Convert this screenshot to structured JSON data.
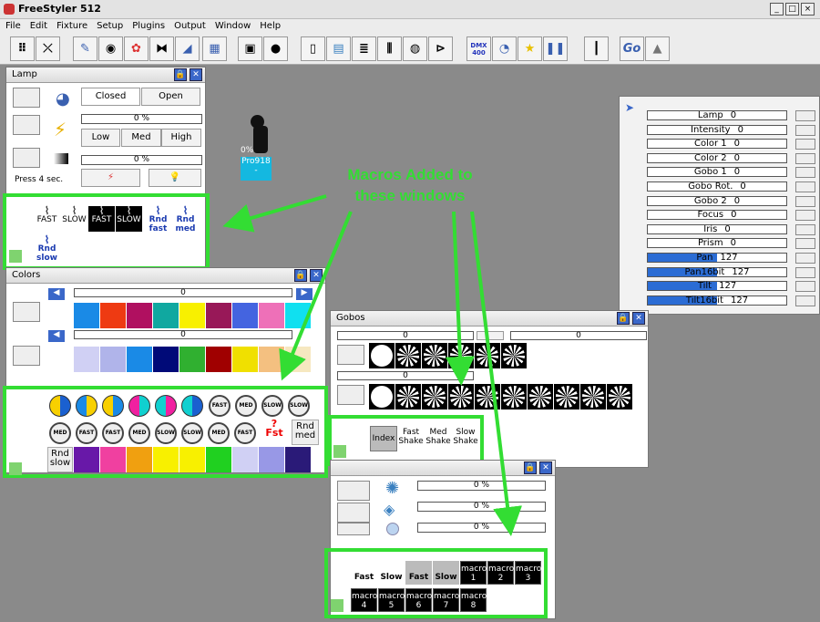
{
  "app": {
    "title": "FreeStyler 512"
  },
  "menu": [
    "File",
    "Edit",
    "Fixture",
    "Setup",
    "Plugins",
    "Output",
    "Window",
    "Help"
  ],
  "toolbar": {
    "dmx_label": "DMX",
    "dmx_sub": "400",
    "go_label": "Go"
  },
  "lamp": {
    "title": "Lamp",
    "closed": "Closed",
    "open": "Open",
    "percent1": "0 %",
    "low": "Low",
    "med": "Med",
    "high": "High",
    "percent2": "0 %",
    "press_label": "Press 4 sec.",
    "macros": [
      {
        "label": "FAST",
        "style": "w"
      },
      {
        "label": "SLOW",
        "style": "w"
      },
      {
        "label": "FAST",
        "style": "b"
      },
      {
        "label": "SLOW",
        "style": "b"
      },
      {
        "label": "Rnd fast",
        "style": "r"
      },
      {
        "label": "Rnd med",
        "style": "r"
      },
      {
        "label": "Rnd slow",
        "style": "r"
      }
    ]
  },
  "fixture": {
    "label": "Pro918",
    "value": "0%",
    "sub": "-"
  },
  "annotation": {
    "text": "Macros Added to these windows",
    "color": "#33dd33"
  },
  "channels": [
    {
      "label": "Lamp",
      "value": "0",
      "fill": 0
    },
    {
      "label": "Intensity",
      "value": "0",
      "fill": 0
    },
    {
      "label": "Color 1",
      "value": "0",
      "fill": 0
    },
    {
      "label": "Color 2",
      "value": "0",
      "fill": 0
    },
    {
      "label": "Gobo 1",
      "value": "0",
      "fill": 0
    },
    {
      "label": "Gobo Rot.",
      "value": "0",
      "fill": 0
    },
    {
      "label": "Gobo 2",
      "value": "0",
      "fill": 0
    },
    {
      "label": "Focus",
      "value": "0",
      "fill": 0
    },
    {
      "label": "Iris",
      "value": "0",
      "fill": 0
    },
    {
      "label": "Prism",
      "value": "0",
      "fill": 0
    },
    {
      "label": "Pan",
      "value": "127",
      "fill": 0.5
    },
    {
      "label": "Pan16bit",
      "value": "127",
      "fill": 0.5
    },
    {
      "label": "Tilt",
      "value": "127",
      "fill": 0.5
    },
    {
      "label": "Tilt16bit",
      "value": "127",
      "fill": 0.5
    }
  ],
  "colors": {
    "title": "Colors",
    "slider1": "0",
    "slider2": "0",
    "row1": [
      "#1a8ae6",
      "#ee3a12",
      "#b01060",
      "#10a8a0",
      "#f8f000",
      "#981858",
      "#4464e0",
      "#ee70b8",
      "#10e0f0"
    ],
    "row2": [
      "#d0d0f4",
      "#b0b4ea",
      "#1a8ae6",
      "#000a78",
      "#30b030",
      "#a00000",
      "#f0e000",
      "#f4c080",
      "#f6e8c0"
    ],
    "macro_row3_label": "Rnd slow",
    "macro_row3_colors": [
      "#6818a8",
      "#f040a0",
      "#f0a010",
      "#f8f000",
      "#f8f000",
      "#20d020",
      "#d0d0f4",
      "#9898e6",
      "#2a1a78"
    ],
    "macro_rnd_med": "Rnd med",
    "macro_fst": "Fst",
    "macro_fst_q": "?",
    "fast": "FAST",
    "med": "MED",
    "slow": "SLOW"
  },
  "gobos": {
    "title": "Gobos",
    "slider1": "0",
    "slider2": "0",
    "slider3": "0",
    "index_label": "Index",
    "macros": [
      "Fast Shake",
      "Med Shake",
      "Slow Shake"
    ]
  },
  "effects": {
    "percent1": "0 %",
    "percent2": "0 %",
    "percent3": "0 %",
    "macros": [
      "Fast",
      "Slow",
      "Fast",
      "Slow"
    ],
    "macro_buttons": [
      "macro 1",
      "macro 2",
      "macro 3",
      "macro 4",
      "macro 5",
      "macro 6",
      "macro 7",
      "macro 8"
    ]
  }
}
